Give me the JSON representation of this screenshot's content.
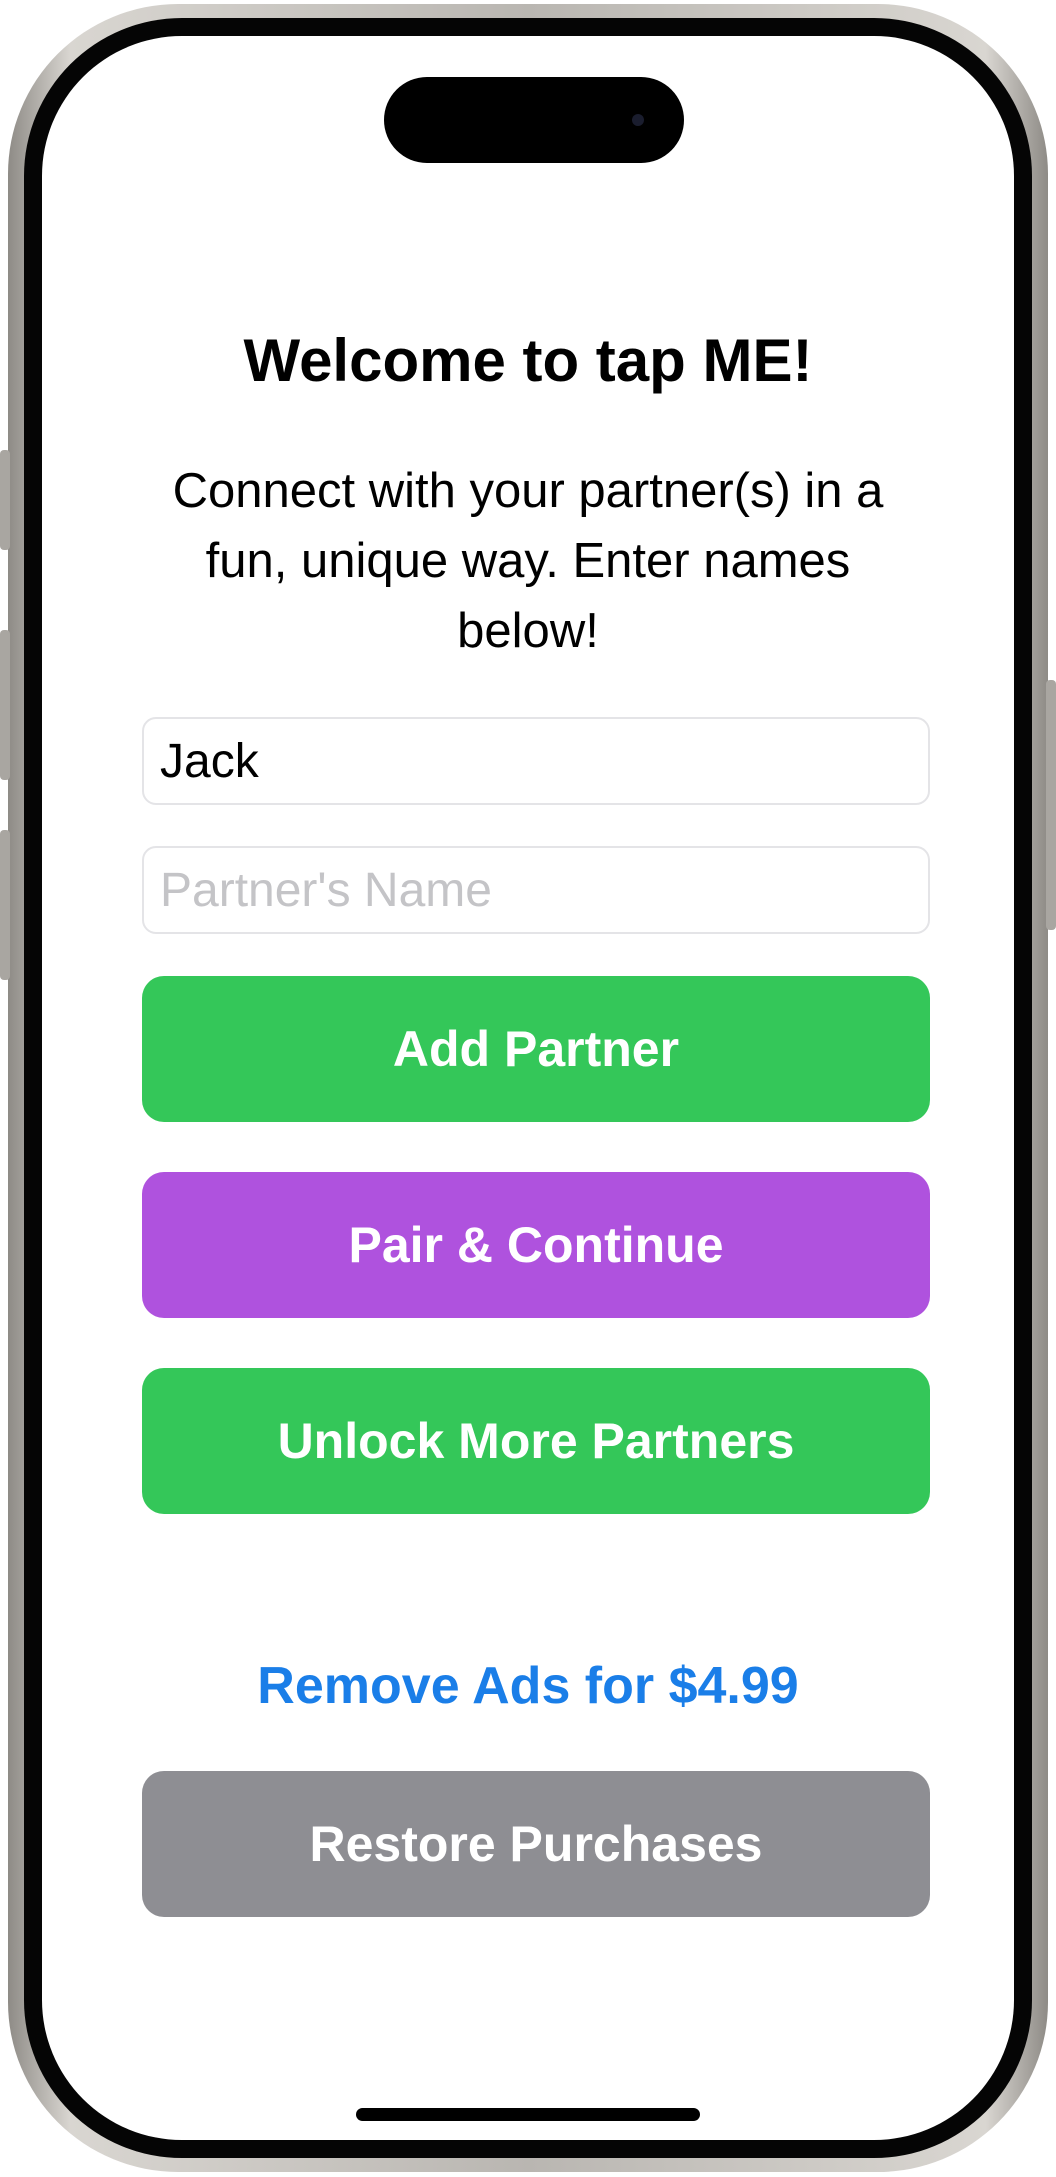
{
  "welcome": {
    "title": "Welcome to tap ME!",
    "subtitle": "Connect with your partner(s) in a fun, unique way. Enter names below!"
  },
  "form": {
    "name_value": "Jack",
    "partner_placeholder": "Partner's Name"
  },
  "buttons": {
    "add_partner": "Add Partner",
    "pair_continue": "Pair & Continue",
    "unlock_more": "Unlock More Partners",
    "remove_ads": "Remove Ads for $4.99",
    "restore_purchases": "Restore Purchases"
  },
  "colors": {
    "green": "#34c759",
    "purple": "#af52de",
    "blue_link": "#1a7ee8",
    "gray": "#8e8e93"
  }
}
